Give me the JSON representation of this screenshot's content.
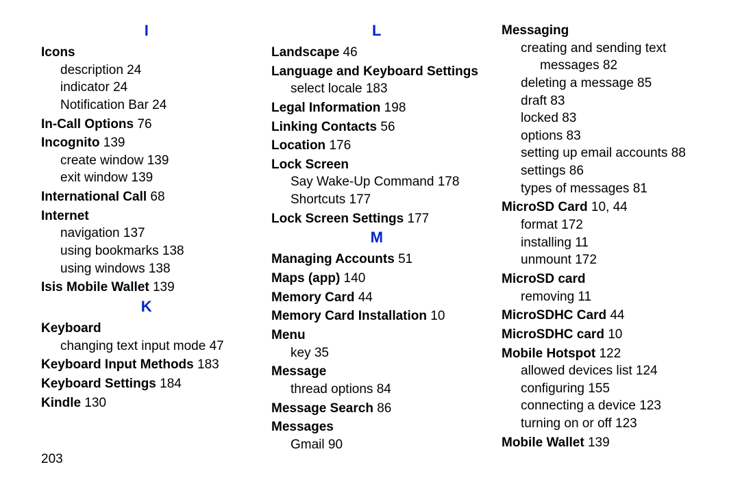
{
  "page_number": "203",
  "columns": [
    {
      "blocks": [
        {
          "type": "letter",
          "text": "I"
        },
        {
          "type": "topic",
          "text": "Icons",
          "pages": ""
        },
        {
          "type": "sub",
          "text": "description",
          "pages": "24"
        },
        {
          "type": "sub",
          "text": "indicator",
          "pages": "24"
        },
        {
          "type": "sub",
          "text": "Notification Bar",
          "pages": "24"
        },
        {
          "type": "topic",
          "text": "In-Call Options",
          "pages": "76"
        },
        {
          "type": "topic",
          "text": "Incognito",
          "pages": "139"
        },
        {
          "type": "sub",
          "text": "create window",
          "pages": "139"
        },
        {
          "type": "sub",
          "text": "exit window",
          "pages": "139"
        },
        {
          "type": "topic",
          "text": "International Call",
          "pages": "68"
        },
        {
          "type": "topic",
          "text": "Internet",
          "pages": ""
        },
        {
          "type": "sub",
          "text": "navigation",
          "pages": "137"
        },
        {
          "type": "sub",
          "text": "using bookmarks",
          "pages": "138"
        },
        {
          "type": "sub",
          "text": "using windows",
          "pages": "138"
        },
        {
          "type": "topic",
          "text": "Isis Mobile Wallet",
          "pages": "139"
        },
        {
          "type": "letter",
          "text": "K"
        },
        {
          "type": "topic",
          "text": "Keyboard",
          "pages": ""
        },
        {
          "type": "sub",
          "text": "changing text input mode",
          "pages": "47"
        },
        {
          "type": "topic",
          "text": "Keyboard Input Methods",
          "pages": "183"
        },
        {
          "type": "topic",
          "text": "Keyboard Settings",
          "pages": "184"
        },
        {
          "type": "topic",
          "text": "Kindle",
          "pages": "130"
        }
      ]
    },
    {
      "blocks": [
        {
          "type": "letter",
          "text": "L"
        },
        {
          "type": "topic",
          "text": "Landscape",
          "pages": "46"
        },
        {
          "type": "topic",
          "text": "Language and Keyboard Settings",
          "pages": ""
        },
        {
          "type": "sub",
          "text": "select locale",
          "pages": "183"
        },
        {
          "type": "topic",
          "text": "Legal Information",
          "pages": "198"
        },
        {
          "type": "topic",
          "text": "Linking Contacts",
          "pages": "56"
        },
        {
          "type": "topic",
          "text": "Location",
          "pages": "176"
        },
        {
          "type": "topic",
          "text": "Lock Screen",
          "pages": ""
        },
        {
          "type": "sub",
          "text": "Say Wake-Up Command",
          "pages": "178"
        },
        {
          "type": "sub",
          "text": "Shortcuts",
          "pages": "177"
        },
        {
          "type": "topic",
          "text": "Lock Screen Settings",
          "pages": "177"
        },
        {
          "type": "letter",
          "text": "M"
        },
        {
          "type": "topic",
          "text": "Managing Accounts",
          "pages": "51"
        },
        {
          "type": "topic",
          "text": "Maps (app)",
          "pages": "140"
        },
        {
          "type": "topic",
          "text": "Memory Card",
          "pages": "44"
        },
        {
          "type": "topic",
          "text": "Memory Card Installation",
          "pages": "10"
        },
        {
          "type": "topic",
          "text": "Menu",
          "pages": ""
        },
        {
          "type": "sub",
          "text": "key",
          "pages": "35"
        },
        {
          "type": "topic",
          "text": "Message",
          "pages": ""
        },
        {
          "type": "sub",
          "text": "thread options",
          "pages": "84"
        },
        {
          "type": "topic",
          "text": "Message Search",
          "pages": "86"
        },
        {
          "type": "topic",
          "text": "Messages",
          "pages": ""
        },
        {
          "type": "sub",
          "text": "Gmail",
          "pages": "90"
        }
      ]
    },
    {
      "blocks": [
        {
          "type": "topic",
          "text": "Messaging",
          "pages": ""
        },
        {
          "type": "sub",
          "text": "creating and sending text",
          "pages": ""
        },
        {
          "type": "subdeep",
          "text": "messages",
          "pages": "82"
        },
        {
          "type": "sub",
          "text": "deleting a message",
          "pages": "85"
        },
        {
          "type": "sub",
          "text": "draft",
          "pages": "83"
        },
        {
          "type": "sub",
          "text": "locked",
          "pages": "83"
        },
        {
          "type": "sub",
          "text": "options",
          "pages": "83"
        },
        {
          "type": "sub",
          "text": "setting up email accounts",
          "pages": "88"
        },
        {
          "type": "sub",
          "text": "settings",
          "pages": "86"
        },
        {
          "type": "sub",
          "text": "types of messages",
          "pages": "81"
        },
        {
          "type": "topic",
          "text": "MicroSD Card",
          "pages": "10, 44"
        },
        {
          "type": "sub",
          "text": "format",
          "pages": "172"
        },
        {
          "type": "sub",
          "text": "installing",
          "pages": "11"
        },
        {
          "type": "sub",
          "text": "unmount",
          "pages": "172"
        },
        {
          "type": "topic",
          "text": "MicroSD card",
          "pages": ""
        },
        {
          "type": "sub",
          "text": "removing",
          "pages": "11"
        },
        {
          "type": "topic",
          "text": "MicroSDHC Card",
          "pages": "44"
        },
        {
          "type": "topic",
          "text": "MicroSDHC card",
          "pages": "10"
        },
        {
          "type": "topic",
          "text": "Mobile Hotspot",
          "pages": "122"
        },
        {
          "type": "sub",
          "text": "allowed devices list",
          "pages": "124"
        },
        {
          "type": "sub",
          "text": "configuring",
          "pages": "155"
        },
        {
          "type": "sub",
          "text": "connecting a device",
          "pages": "123"
        },
        {
          "type": "sub",
          "text": "turning on or off",
          "pages": "123"
        },
        {
          "type": "topic",
          "text": "Mobile Wallet",
          "pages": "139"
        }
      ]
    }
  ]
}
